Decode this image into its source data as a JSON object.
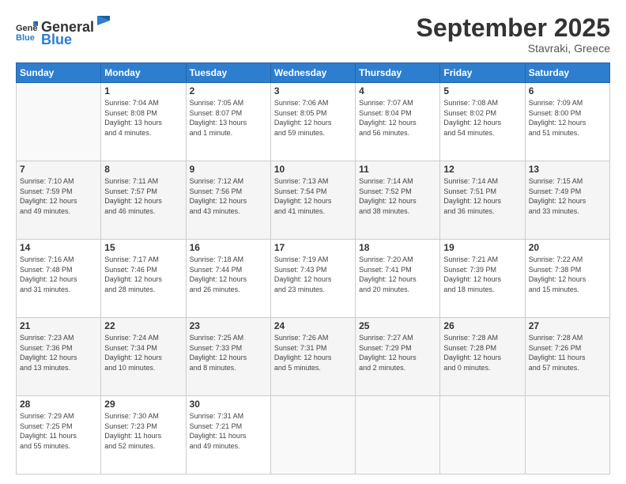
{
  "header": {
    "logo_general": "General",
    "logo_blue": "Blue",
    "month_title": "September 2025",
    "subtitle": "Stavraki, Greece"
  },
  "days_of_week": [
    "Sunday",
    "Monday",
    "Tuesday",
    "Wednesday",
    "Thursday",
    "Friday",
    "Saturday"
  ],
  "weeks": [
    [
      {
        "day": "",
        "info": ""
      },
      {
        "day": "1",
        "info": "Sunrise: 7:04 AM\nSunset: 8:08 PM\nDaylight: 13 hours\nand 4 minutes."
      },
      {
        "day": "2",
        "info": "Sunrise: 7:05 AM\nSunset: 8:07 PM\nDaylight: 13 hours\nand 1 minute."
      },
      {
        "day": "3",
        "info": "Sunrise: 7:06 AM\nSunset: 8:05 PM\nDaylight: 12 hours\nand 59 minutes."
      },
      {
        "day": "4",
        "info": "Sunrise: 7:07 AM\nSunset: 8:04 PM\nDaylight: 12 hours\nand 56 minutes."
      },
      {
        "day": "5",
        "info": "Sunrise: 7:08 AM\nSunset: 8:02 PM\nDaylight: 12 hours\nand 54 minutes."
      },
      {
        "day": "6",
        "info": "Sunrise: 7:09 AM\nSunset: 8:00 PM\nDaylight: 12 hours\nand 51 minutes."
      }
    ],
    [
      {
        "day": "7",
        "info": "Sunrise: 7:10 AM\nSunset: 7:59 PM\nDaylight: 12 hours\nand 49 minutes."
      },
      {
        "day": "8",
        "info": "Sunrise: 7:11 AM\nSunset: 7:57 PM\nDaylight: 12 hours\nand 46 minutes."
      },
      {
        "day": "9",
        "info": "Sunrise: 7:12 AM\nSunset: 7:56 PM\nDaylight: 12 hours\nand 43 minutes."
      },
      {
        "day": "10",
        "info": "Sunrise: 7:13 AM\nSunset: 7:54 PM\nDaylight: 12 hours\nand 41 minutes."
      },
      {
        "day": "11",
        "info": "Sunrise: 7:14 AM\nSunset: 7:52 PM\nDaylight: 12 hours\nand 38 minutes."
      },
      {
        "day": "12",
        "info": "Sunrise: 7:14 AM\nSunset: 7:51 PM\nDaylight: 12 hours\nand 36 minutes."
      },
      {
        "day": "13",
        "info": "Sunrise: 7:15 AM\nSunset: 7:49 PM\nDaylight: 12 hours\nand 33 minutes."
      }
    ],
    [
      {
        "day": "14",
        "info": "Sunrise: 7:16 AM\nSunset: 7:48 PM\nDaylight: 12 hours\nand 31 minutes."
      },
      {
        "day": "15",
        "info": "Sunrise: 7:17 AM\nSunset: 7:46 PM\nDaylight: 12 hours\nand 28 minutes."
      },
      {
        "day": "16",
        "info": "Sunrise: 7:18 AM\nSunset: 7:44 PM\nDaylight: 12 hours\nand 26 minutes."
      },
      {
        "day": "17",
        "info": "Sunrise: 7:19 AM\nSunset: 7:43 PM\nDaylight: 12 hours\nand 23 minutes."
      },
      {
        "day": "18",
        "info": "Sunrise: 7:20 AM\nSunset: 7:41 PM\nDaylight: 12 hours\nand 20 minutes."
      },
      {
        "day": "19",
        "info": "Sunrise: 7:21 AM\nSunset: 7:39 PM\nDaylight: 12 hours\nand 18 minutes."
      },
      {
        "day": "20",
        "info": "Sunrise: 7:22 AM\nSunset: 7:38 PM\nDaylight: 12 hours\nand 15 minutes."
      }
    ],
    [
      {
        "day": "21",
        "info": "Sunrise: 7:23 AM\nSunset: 7:36 PM\nDaylight: 12 hours\nand 13 minutes."
      },
      {
        "day": "22",
        "info": "Sunrise: 7:24 AM\nSunset: 7:34 PM\nDaylight: 12 hours\nand 10 minutes."
      },
      {
        "day": "23",
        "info": "Sunrise: 7:25 AM\nSunset: 7:33 PM\nDaylight: 12 hours\nand 8 minutes."
      },
      {
        "day": "24",
        "info": "Sunrise: 7:26 AM\nSunset: 7:31 PM\nDaylight: 12 hours\nand 5 minutes."
      },
      {
        "day": "25",
        "info": "Sunrise: 7:27 AM\nSunset: 7:29 PM\nDaylight: 12 hours\nand 2 minutes."
      },
      {
        "day": "26",
        "info": "Sunrise: 7:28 AM\nSunset: 7:28 PM\nDaylight: 12 hours\nand 0 minutes."
      },
      {
        "day": "27",
        "info": "Sunrise: 7:28 AM\nSunset: 7:26 PM\nDaylight: 11 hours\nand 57 minutes."
      }
    ],
    [
      {
        "day": "28",
        "info": "Sunrise: 7:29 AM\nSunset: 7:25 PM\nDaylight: 11 hours\nand 55 minutes."
      },
      {
        "day": "29",
        "info": "Sunrise: 7:30 AM\nSunset: 7:23 PM\nDaylight: 11 hours\nand 52 minutes."
      },
      {
        "day": "30",
        "info": "Sunrise: 7:31 AM\nSunset: 7:21 PM\nDaylight: 11 hours\nand 49 minutes."
      },
      {
        "day": "",
        "info": ""
      },
      {
        "day": "",
        "info": ""
      },
      {
        "day": "",
        "info": ""
      },
      {
        "day": "",
        "info": ""
      }
    ]
  ]
}
